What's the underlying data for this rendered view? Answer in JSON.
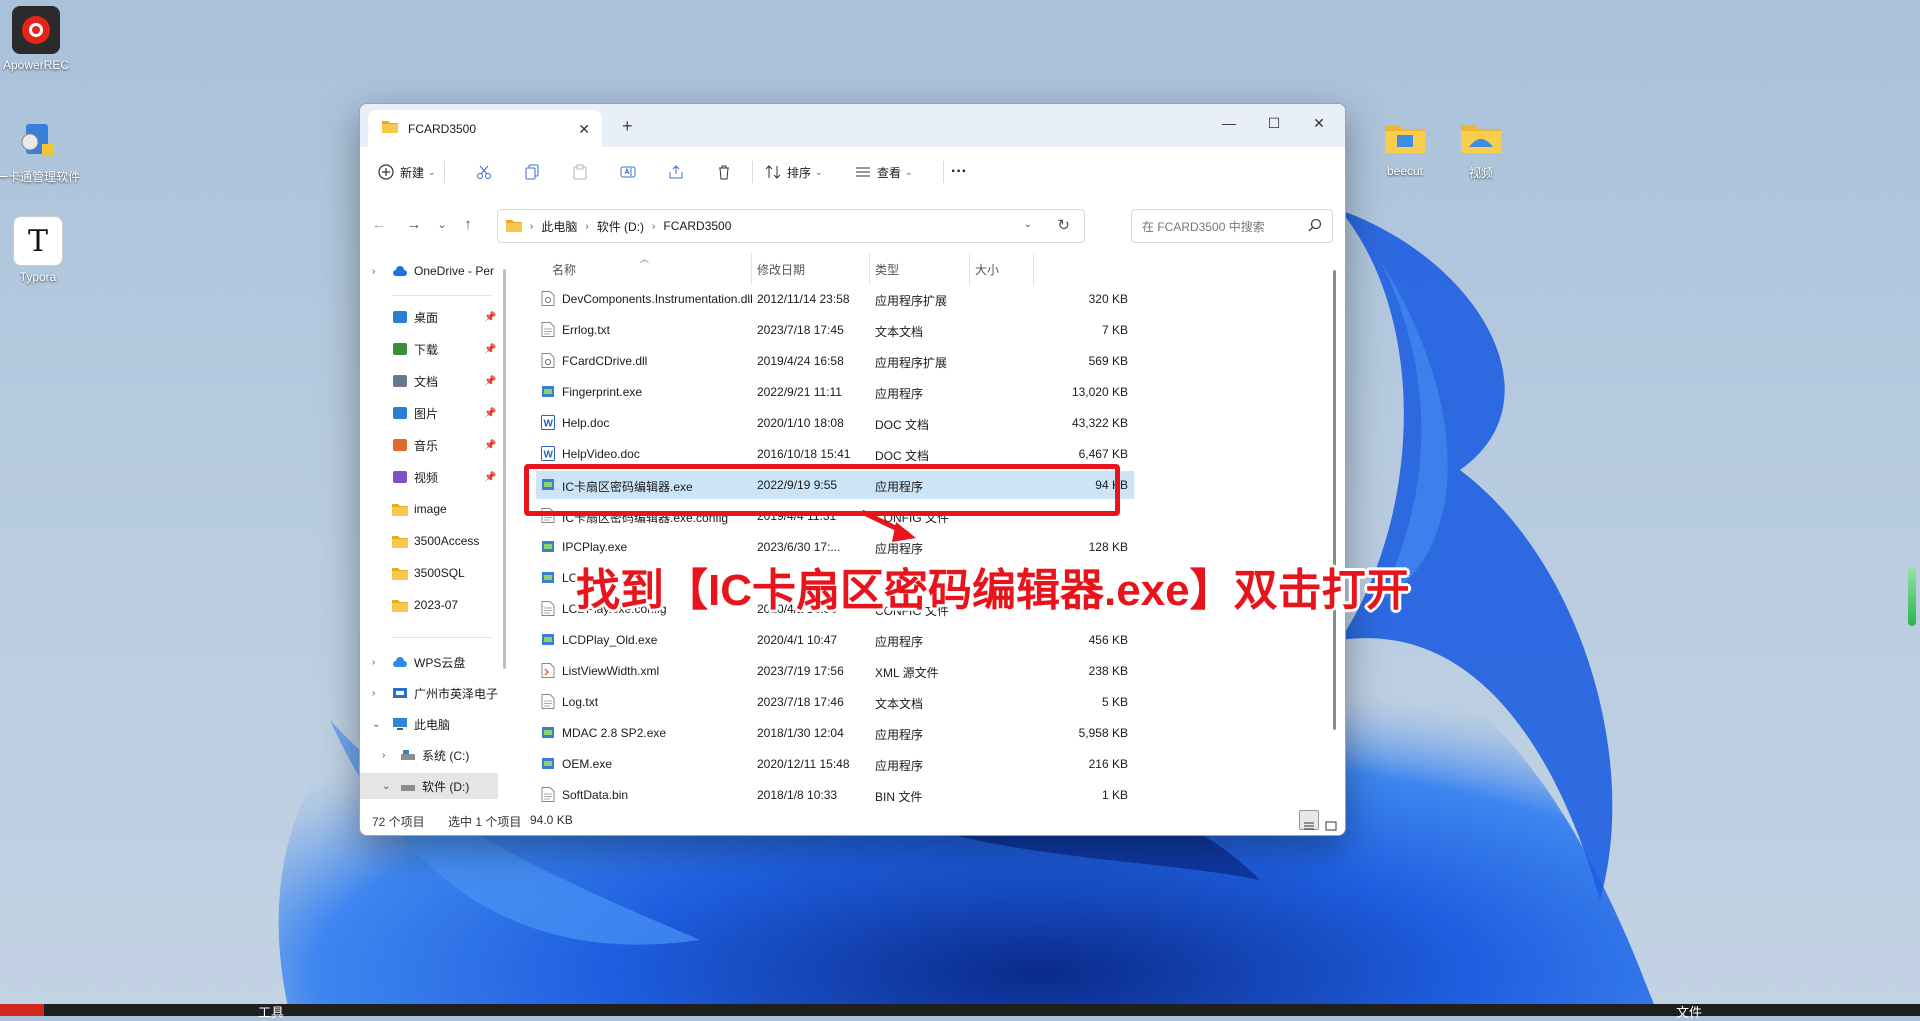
{
  "desktop": {
    "icons": [
      {
        "label": "ApowerREC",
        "icon": "record-icon"
      },
      {
        "label": "一卡通管理软件",
        "icon": "card-key-icon"
      },
      {
        "label": "Typora",
        "icon": "typora-icon"
      },
      {
        "label": "beecut",
        "icon": "folder-icon"
      },
      {
        "label": "视频",
        "icon": "folder-icon"
      }
    ],
    "taskbar": {
      "left_text": "工具",
      "right_text": "文件"
    }
  },
  "window": {
    "tab_title": "FCARD3500",
    "toolbar": {
      "new_label": "新建",
      "sort_label": "排序",
      "view_label": "查看",
      "more_label": "···"
    },
    "breadcrumb": [
      "此电脑",
      "软件 (D:)",
      "FCARD3500"
    ],
    "search_placeholder": "在 FCARD3500 中搜索",
    "sidebar": {
      "onedrive": "OneDrive - Per",
      "quick": [
        {
          "label": "桌面",
          "icon": "desktop-icon",
          "color": "#2a7fd4"
        },
        {
          "label": "下载",
          "icon": "download-icon",
          "color": "#3b8e3b"
        },
        {
          "label": "文档",
          "icon": "document-icon",
          "color": "#6a7a8c"
        },
        {
          "label": "图片",
          "icon": "picture-icon",
          "color": "#2a7fd4"
        },
        {
          "label": "音乐",
          "icon": "music-icon",
          "color": "#e06a2b"
        },
        {
          "label": "视频",
          "icon": "video-icon",
          "color": "#7a4fc9"
        }
      ],
      "folders": [
        "image",
        "3500Access",
        "3500SQL",
        "2023-07"
      ],
      "wps": "WPS云盘",
      "company": "广州市英泽电子",
      "this_pc": "此电脑",
      "drive_c": "系统 (C:)",
      "drive_d": "软件 (D:)"
    },
    "columns": {
      "name": "名称",
      "date": "修改日期",
      "type": "类型",
      "size": "大小"
    },
    "files": [
      {
        "name": "DevComponents.Instrumentation.dll",
        "date": "2012/11/14 23:58",
        "type": "应用程序扩展",
        "size": "320 KB",
        "icon": "dll"
      },
      {
        "name": "Errlog.txt",
        "date": "2023/7/18 17:45",
        "type": "文本文档",
        "size": "7 KB",
        "icon": "txt"
      },
      {
        "name": "FCardCDrive.dll",
        "date": "2019/4/24 16:58",
        "type": "应用程序扩展",
        "size": "569 KB",
        "icon": "dll"
      },
      {
        "name": "Fingerprint.exe",
        "date": "2022/9/21 11:11",
        "type": "应用程序",
        "size": "13,020 KB",
        "icon": "exe"
      },
      {
        "name": "Help.doc",
        "date": "2020/1/10 18:08",
        "type": "DOC 文档",
        "size": "43,322 KB",
        "icon": "doc"
      },
      {
        "name": "HelpVideo.doc",
        "date": "2016/10/18 15:41",
        "type": "DOC 文档",
        "size": "6,467 KB",
        "icon": "doc"
      },
      {
        "name": "IC卡扇区密码编辑器.exe",
        "date": "2022/9/19 9:55",
        "type": "应用程序",
        "size": "94 KB",
        "icon": "exe",
        "selected": true
      },
      {
        "name": "IC卡扇区密码编辑器.exe.config",
        "date": "2019/4/4 11:31",
        "type": "CONFIG 文件",
        "size": "",
        "icon": "txt"
      },
      {
        "name": "IPCPlay.exe",
        "date": "2023/6/30 17:...",
        "type": "应用程序",
        "size": "128 KB",
        "icon": "exe"
      },
      {
        "name": "LCD...",
        "date": "",
        "type": "",
        "size": "",
        "icon": "exe"
      },
      {
        "name": "LCDPlay.exe.config",
        "date": "2020/4/2 18:30",
        "type": "CONFIG 文件",
        "size": "",
        "icon": "txt"
      },
      {
        "name": "LCDPlay_Old.exe",
        "date": "2020/4/1 10:47",
        "type": "应用程序",
        "size": "456 KB",
        "icon": "exe"
      },
      {
        "name": "ListViewWidth.xml",
        "date": "2023/7/19 17:56",
        "type": "XML 源文件",
        "size": "238 KB",
        "icon": "xml"
      },
      {
        "name": "Log.txt",
        "date": "2023/7/18 17:46",
        "type": "文本文档",
        "size": "5 KB",
        "icon": "txt"
      },
      {
        "name": "MDAC 2.8 SP2.exe",
        "date": "2018/1/30 12:04",
        "type": "应用程序",
        "size": "5,958 KB",
        "icon": "exe"
      },
      {
        "name": "OEM.exe",
        "date": "2020/12/11 15:48",
        "type": "应用程序",
        "size": "216 KB",
        "icon": "exe"
      },
      {
        "name": "SoftData.bin",
        "date": "2018/1/8 10:33",
        "type": "BIN 文件",
        "size": "1 KB",
        "icon": "txt"
      }
    ],
    "status": {
      "count": "72 个项目",
      "selected": "选中 1 个项目",
      "size": "94.0 KB"
    }
  },
  "annotation": {
    "text": "找到【IC卡扇区密码编辑器.exe】双击打开",
    "color": "#e8141c"
  }
}
